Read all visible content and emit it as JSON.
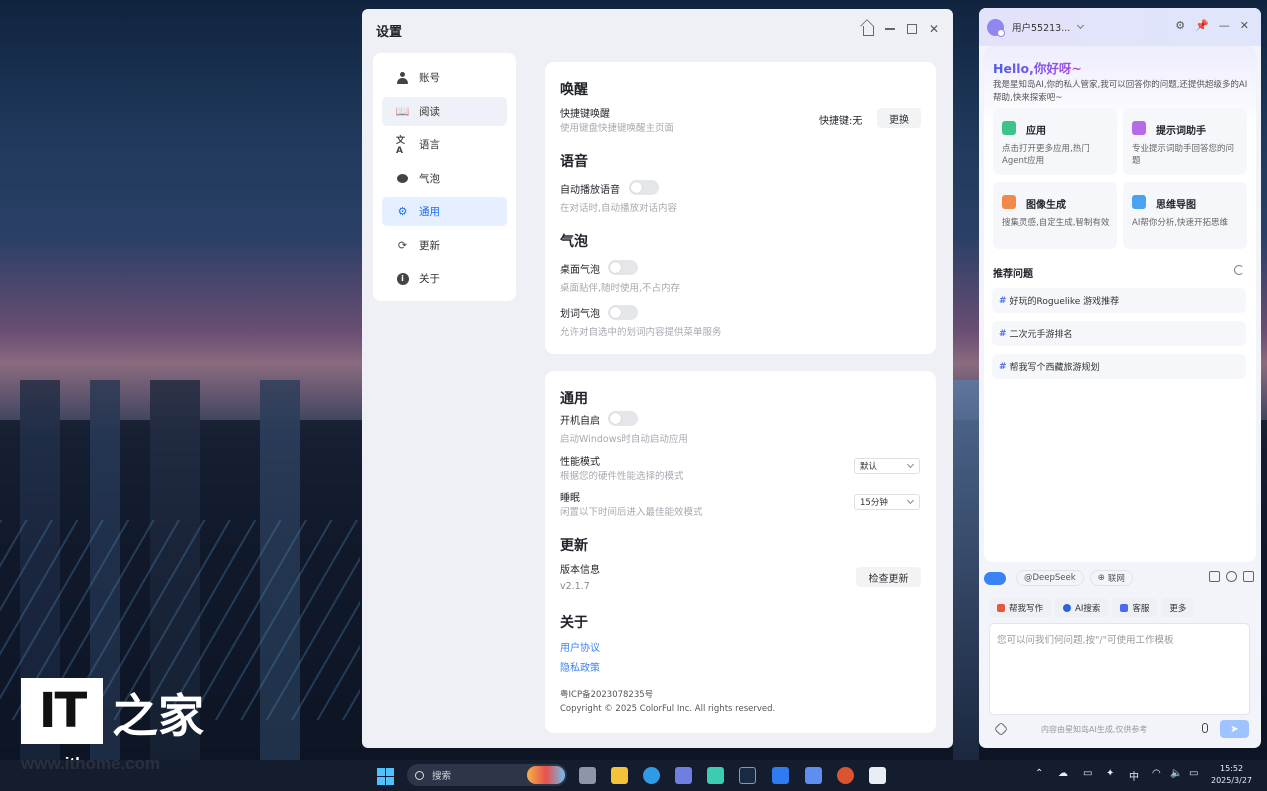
{
  "settings": {
    "title": "设置",
    "nav": [
      {
        "label": "账号",
        "icon": "person-icon"
      },
      {
        "label": "阅读",
        "icon": "book-icon"
      },
      {
        "label": "语言",
        "icon": "translate-icon"
      },
      {
        "label": "气泡",
        "icon": "bubble-icon"
      },
      {
        "label": "通用",
        "icon": "gear-icon"
      },
      {
        "label": "更新",
        "icon": "refresh-icon"
      },
      {
        "label": "关于",
        "icon": "info-icon"
      }
    ],
    "active_nav": "通用",
    "wake": {
      "heading": "唤醒",
      "shortcut_label": "快捷键唤醒",
      "shortcut_desc": "使用键盘快捷键唤醒主页面",
      "shortcut_value": "快捷键:无",
      "change_button": "更换"
    },
    "voice": {
      "heading": "语音",
      "autoplay_label": "自动播放语音",
      "autoplay_desc": "在对话时,自动播放对话内容"
    },
    "bubble": {
      "heading": "气泡",
      "desktop_label": "桌面气泡",
      "desktop_desc": "桌面贴伴,随时使用,不占内存",
      "select_label": "划词气泡",
      "select_desc": "允许对自选中的划词内容提供菜单服务"
    },
    "general": {
      "heading": "通用",
      "startup_label": "开机自启",
      "startup_desc": "启动Windows时自动启动应用",
      "perf_label": "性能模式",
      "perf_desc": "根据您的硬件性能选择的模式",
      "perf_value": "默认",
      "sleep_label": "睡眠",
      "sleep_desc": "闲置以下时间后进入最佳能效模式",
      "sleep_value": "15分钟"
    },
    "update": {
      "heading": "更新",
      "version_label": "版本信息",
      "version": "v2.1.7",
      "check_button": "检查更新"
    },
    "about": {
      "heading": "关于",
      "user_agreement": "用户协议",
      "privacy_policy": "隐私政策",
      "icp": "粤ICP备2023078235号",
      "copyright": "Copyright © 2025 ColorFul Inc. All rights reserved."
    }
  },
  "assistant": {
    "username": "用户55213...",
    "greeting": "Hello,你好呀~",
    "intro": "我是星知岛AI,你的私人管家,我可以回答你的问题,还提供超级多的AI帮助,快来探索吧~",
    "features": [
      {
        "title": "应用",
        "desc": "点击打开更多应用,热门Agent应用",
        "color": "#3cc48a"
      },
      {
        "title": "提示词助手",
        "desc": "专业提示词助手回答您的问题",
        "color": "#b66ae8"
      },
      {
        "title": "图像生成",
        "desc": "搜集灵感,自定生成,智制有效",
        "color": "#f08a4b"
      },
      {
        "title": "思维导图",
        "desc": "AI帮你分析,快速开拓思维",
        "color": "#4aa3f0"
      }
    ],
    "recommend_heading": "推荐问题",
    "questions": [
      "好玩的Roguelike 游戏推荐",
      "二次元手游排名",
      "帮我写个西藏旅游规划"
    ],
    "modes": [
      "@DeepSeek",
      "联网"
    ],
    "actions": [
      {
        "label": "帮我写作",
        "color": "#e8563f"
      },
      {
        "label": "AI搜索",
        "color": "#2f64d8"
      },
      {
        "label": "客服",
        "color": "#4a6cf0"
      },
      {
        "label": "更多",
        "color": ""
      }
    ],
    "input_placeholder": "您可以问我们何问题,按\"/\"可使用工作模板",
    "footer_note": "内容由星知岛AI生成,仅供参考"
  },
  "watermark": {
    "logo_text": "IT",
    "cn_text": "之家",
    "url": "www.ithome.com"
  },
  "taskbar": {
    "search_placeholder": "搜索",
    "ime": "中",
    "time": "15:52",
    "date": "2025/3/27"
  }
}
